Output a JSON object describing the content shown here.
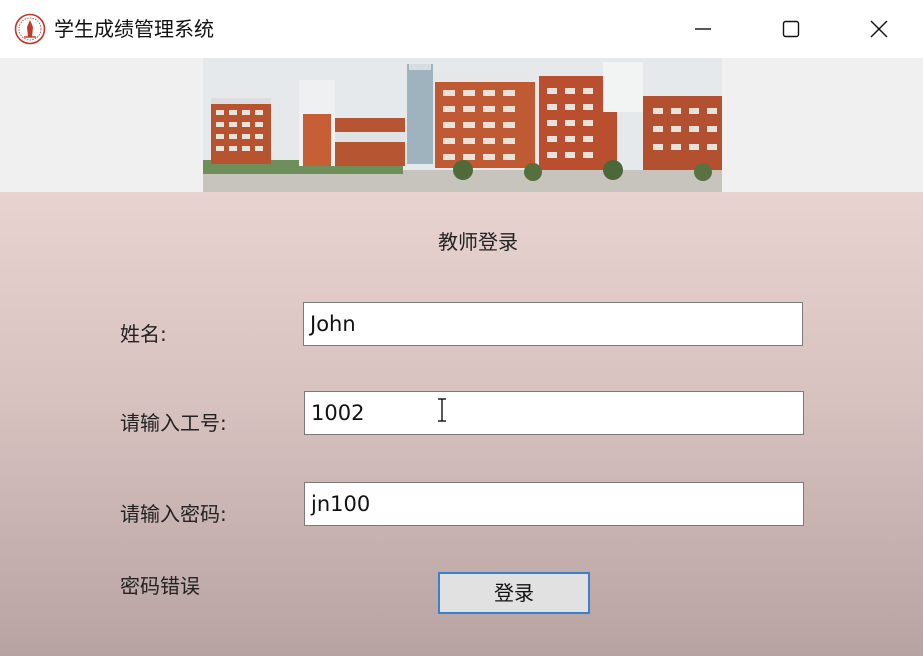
{
  "window": {
    "title": "学生成绩管理系统",
    "icons": {
      "app": "school-emblem-icon",
      "minimize": "minimize-icon",
      "maximize": "maximize-icon",
      "close": "close-icon"
    }
  },
  "banner": {
    "image": "campus-buildings-photo"
  },
  "form": {
    "heading": "教师登录",
    "name_label": "姓名:",
    "name_value": "John",
    "id_label": "请输入工号:",
    "id_value": "1002",
    "password_label": "请输入密码:",
    "password_value": "jn100",
    "error_message": "密码错误",
    "login_button": "登录"
  },
  "colors": {
    "button_border": "#3a7fd0",
    "background_top": "#e9d3d1",
    "background_bottom": "#b7a3a2"
  }
}
